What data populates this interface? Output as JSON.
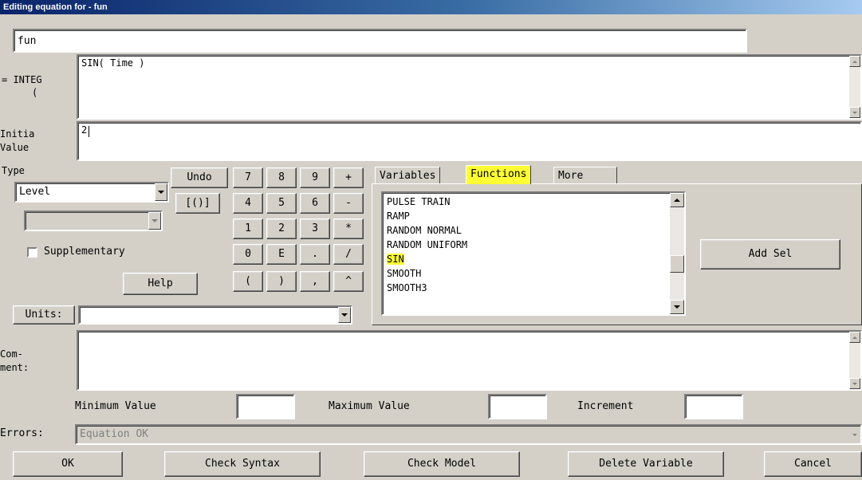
{
  "window": {
    "title": "Editing equation for - fun"
  },
  "variable_name": "fun",
  "equation": {
    "label_line1": "= INTEG",
    "label_line2": "(",
    "value": "SIN( Time )"
  },
  "initial_value": {
    "label_line1": "Initia",
    "label_line2": "Value",
    "value": "2"
  },
  "type": {
    "label": "Type",
    "selected": "Level",
    "subtype_selected": "",
    "supplementary_label": "Supplementary",
    "supplementary_checked": false
  },
  "buttons": {
    "undo": "Undo",
    "brackets": "[()]",
    "help": "Help",
    "units": "Units:",
    "add_sel": "Add Sel",
    "ok": "OK",
    "check_syntax": "Check Syntax",
    "check_model": "Check Model",
    "delete_variable": "Delete Variable",
    "cancel": "Cancel"
  },
  "keypad": [
    [
      "7",
      "8",
      "9",
      "+"
    ],
    [
      "4",
      "5",
      "6",
      "-"
    ],
    [
      "1",
      "2",
      "3",
      "*"
    ],
    [
      "0",
      "E",
      ".",
      "/"
    ],
    [
      "(",
      ")",
      ",",
      "^"
    ]
  ],
  "tabs": [
    "Variables",
    "Functions",
    "More"
  ],
  "active_tab": "Functions",
  "functions_list": [
    "PULSE TRAIN",
    "RAMP",
    "RANDOM NORMAL",
    "RANDOM UNIFORM",
    "SIN",
    "SMOOTH",
    "SMOOTH3"
  ],
  "selected_function": "SIN",
  "units": {
    "value": ""
  },
  "comment": {
    "label_line1": "Com-",
    "label_line2": "ment:",
    "value": ""
  },
  "range": {
    "min_label": "Minimum Value",
    "min_value": "",
    "max_label": "Maximum Value",
    "max_value": "",
    "inc_label": "Increment",
    "inc_value": ""
  },
  "errors": {
    "label": "Errors:",
    "value": "Equation OK"
  },
  "colors": {
    "highlight": "#ffff33",
    "face": "#d4d0c8",
    "title_start": "#0a246a",
    "title_end": "#a6caf0"
  }
}
